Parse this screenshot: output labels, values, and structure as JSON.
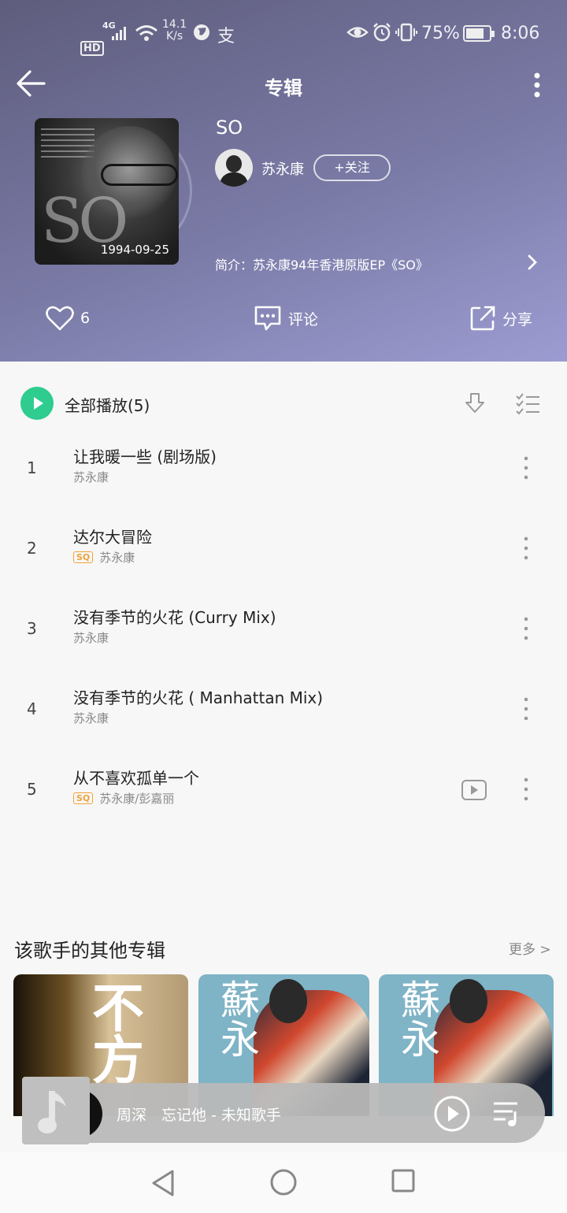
{
  "status_bar": {
    "hd": "HD",
    "network": "4G",
    "speed_value": "14.1",
    "speed_unit": "K/s",
    "alipay": "支",
    "battery": "75%",
    "time": "8:06"
  },
  "header": {
    "title": "专辑",
    "album_name": "SO",
    "cover_date": "1994-09-25",
    "artist": "苏永康",
    "follow_label": "+关注",
    "intro": "简介：苏永康94年香港原版EP《SO》",
    "likes": "6",
    "comment_label": "评论",
    "share_label": "分享"
  },
  "track_list": {
    "play_all_label": "全部播放(5)",
    "tracks": [
      {
        "num": "1",
        "title": "让我暖一些 (剧场版)",
        "artist": "苏永康",
        "sq": false,
        "mv": false
      },
      {
        "num": "2",
        "title": "达尔大冒险",
        "artist": "苏永康",
        "sq": true,
        "mv": false
      },
      {
        "num": "3",
        "title": "没有季节的火花 (Curry Mix)",
        "artist": "苏永康",
        "sq": false,
        "mv": false
      },
      {
        "num": "4",
        "title": "没有季节的火花 ( Manhattan Mix)",
        "artist": "苏永康",
        "sq": false,
        "mv": false
      },
      {
        "num": "5",
        "title": "从不喜欢孤单一个",
        "artist": "苏永康/彭嘉丽",
        "sq": true,
        "mv": true
      }
    ],
    "sq_label": "SQ"
  },
  "other_albums": {
    "title": "该歌手的其他专辑",
    "more_label": "更多 >",
    "thumb1_text": "不方",
    "thumb2_text": "蘇永",
    "thumb3_text": "蘇永"
  },
  "mini_player": {
    "song": "周深　忘记他 - 未知歌手"
  },
  "colors": {
    "accent_green": "#2ecc8f",
    "sq_orange": "#f0a33a",
    "header_start": "#5e5d7d",
    "header_end": "#9c9cd2"
  }
}
